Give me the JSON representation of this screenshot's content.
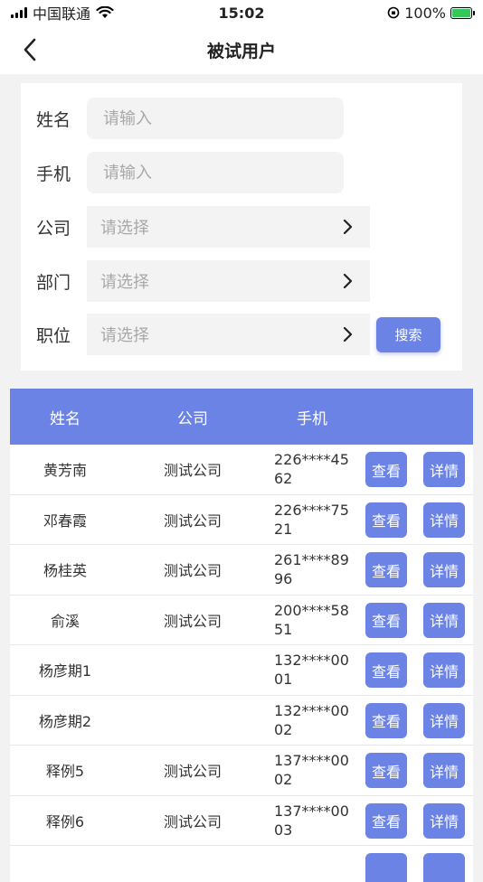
{
  "status_bar": {
    "carrier": "中国联通",
    "time": "15:02",
    "battery": "100%"
  },
  "nav": {
    "title": "被试用户"
  },
  "form": {
    "name_label": "姓名",
    "name_placeholder": "请输入",
    "phone_label": "手机",
    "phone_placeholder": "请输入",
    "company_label": "公司",
    "company_placeholder": "请选择",
    "department_label": "部门",
    "department_placeholder": "请选择",
    "position_label": "职位",
    "position_placeholder": "请选择",
    "search_label": "搜索"
  },
  "table": {
    "columns": [
      "姓名",
      "公司",
      "手机"
    ],
    "view_label": "查看",
    "detail_label": "详情",
    "rows": [
      {
        "name": "黄芳南",
        "company": "测试公司",
        "phone": "226****4562"
      },
      {
        "name": "邓春霞",
        "company": "测试公司",
        "phone": "226****7521"
      },
      {
        "name": "杨桂英",
        "company": "测试公司",
        "phone": "261****8996"
      },
      {
        "name": "俞溪",
        "company": "测试公司",
        "phone": "200****5851"
      },
      {
        "name": "杨彦期1",
        "company": "",
        "phone": "132****0001"
      },
      {
        "name": "杨彦期2",
        "company": "",
        "phone": "132****0002"
      },
      {
        "name": "释例5",
        "company": "测试公司",
        "phone": "137****0002"
      },
      {
        "name": "释例6",
        "company": "测试公司",
        "phone": "137****0003"
      }
    ]
  }
}
